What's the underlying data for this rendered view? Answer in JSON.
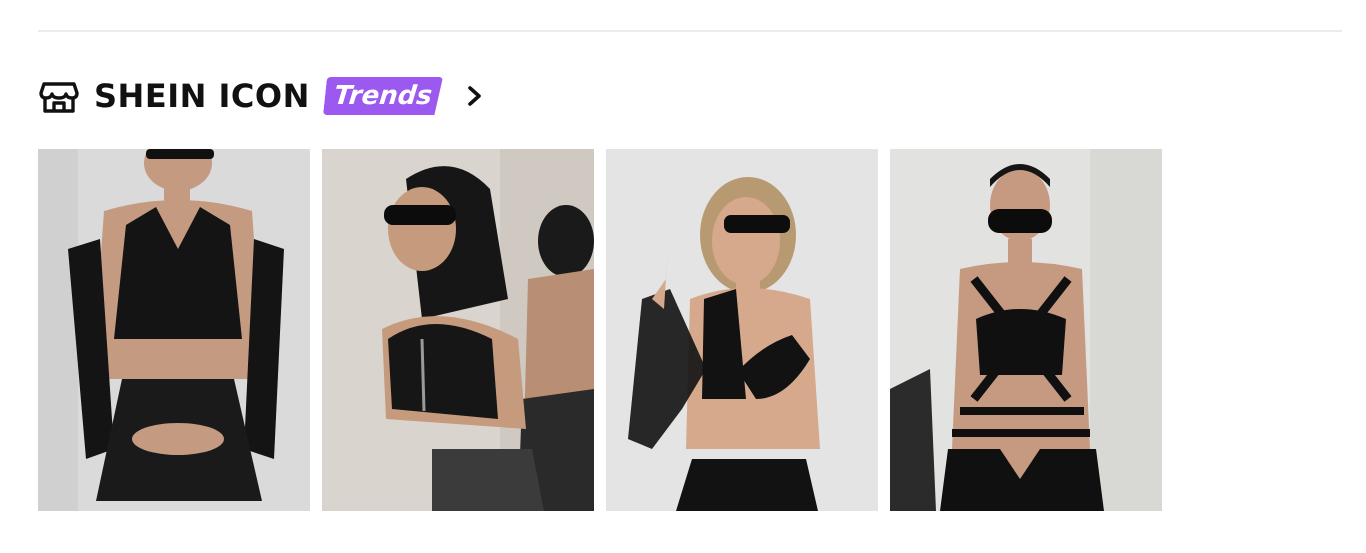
{
  "section": {
    "brand_name": "SHEIN ICON",
    "badge_label": "Trends",
    "icon": "store-icon",
    "more_icon": "chevron-right-icon",
    "badge_color": "#9b59ef"
  },
  "products": [
    {
      "name": "product-1",
      "background": "#dadada",
      "outfit": "#141414"
    },
    {
      "name": "product-2",
      "background": "#d9d4ce",
      "outfit": "#161616"
    },
    {
      "name": "product-3",
      "background": "#e4e4e4",
      "outfit": "#121212"
    },
    {
      "name": "product-4",
      "background": "#e2e2e0",
      "outfit": "#101010"
    }
  ]
}
